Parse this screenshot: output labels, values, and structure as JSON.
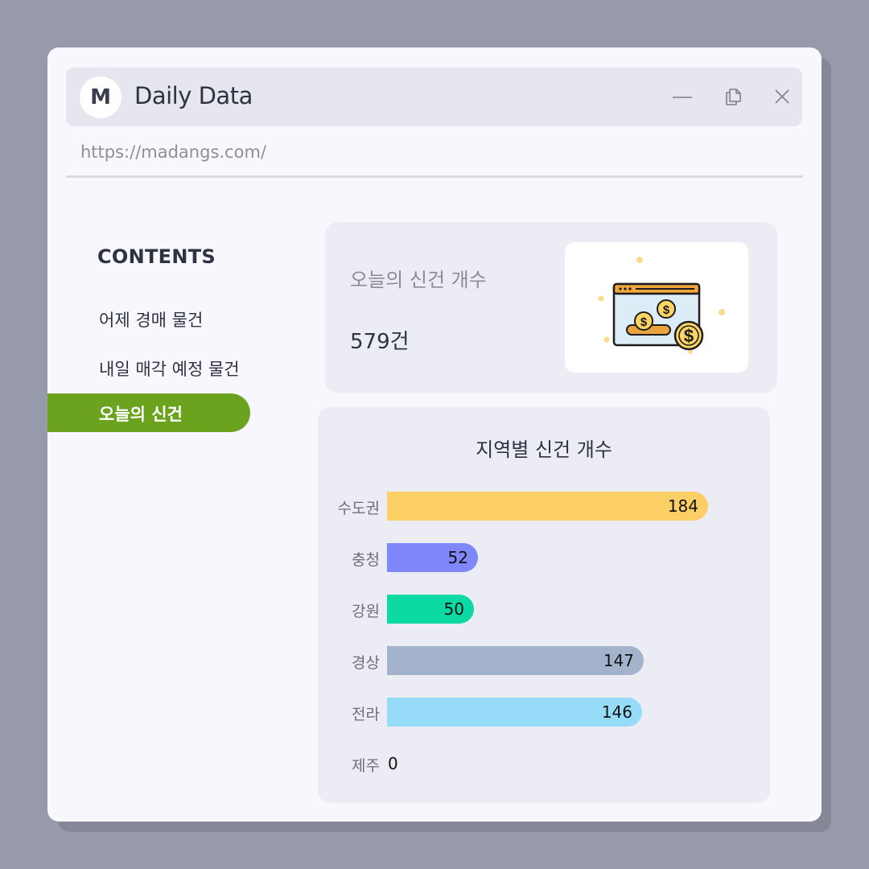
{
  "window": {
    "title": "Daily Data",
    "avatar_letter": "M",
    "url": "https://madangs.com/"
  },
  "sidebar": {
    "title": "CONTENTS",
    "items": [
      {
        "label": "어제 경매 물건",
        "active": false
      },
      {
        "label": "내일 매각 예정 물건",
        "active": false
      },
      {
        "label": "오늘의 신건",
        "active": true
      }
    ]
  },
  "summary": {
    "label": "오늘의 신건 개수",
    "value": "579건",
    "icon": "money-browser-illustration"
  },
  "chart_data": {
    "type": "bar",
    "orientation": "horizontal",
    "title": "지역별 신건 개수",
    "categories": [
      "수도권",
      "충청",
      "강원",
      "경상",
      "전라",
      "제주"
    ],
    "values": [
      184,
      52,
      50,
      147,
      146,
      0
    ],
    "colors": [
      "#fbcf66",
      "#7f87fb",
      "#0dd9a3",
      "#a4b2cc",
      "#96dcf8",
      "#cccccc"
    ],
    "xlim": [
      0,
      184
    ],
    "grid": false,
    "legend": "none"
  },
  "colors": {
    "accent": "#6ba31f",
    "background": "#979aab",
    "window": "#f7f7fd",
    "card": "#ececf5"
  }
}
